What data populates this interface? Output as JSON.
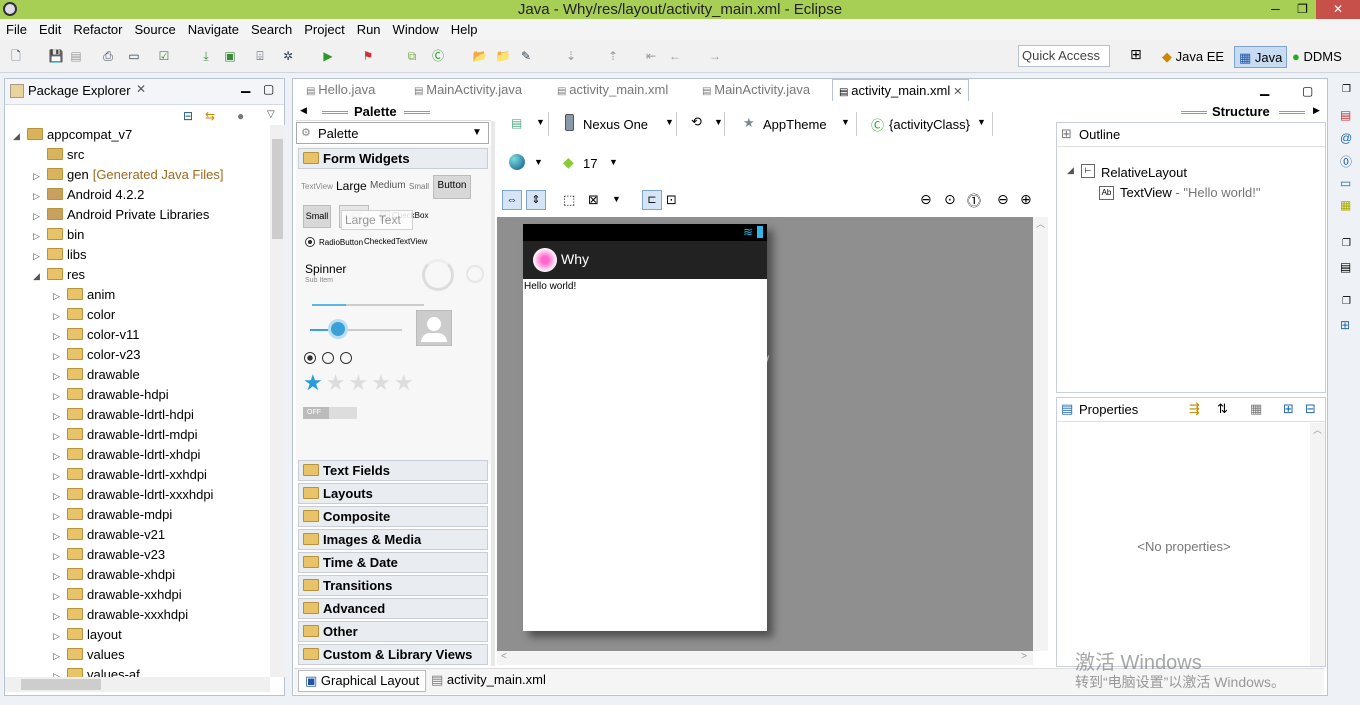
{
  "window": {
    "title": "Java - Why/res/layout/activity_main.xml - Eclipse"
  },
  "menu": [
    "File",
    "Edit",
    "Refactor",
    "Source",
    "Navigate",
    "Search",
    "Project",
    "Run",
    "Window",
    "Help"
  ],
  "toolbar": {
    "quick_access": "Quick Access",
    "perspectives": [
      "Java EE",
      "Java",
      "DDMS"
    ]
  },
  "package_explorer": {
    "title": "Package Explorer",
    "items": [
      {
        "label": "appcompat_v7",
        "depth": 0,
        "arrow": "expanded",
        "icon": "project-icon"
      },
      {
        "label": "src",
        "depth": 1,
        "arrow": "none",
        "icon": "src-folder-icon"
      },
      {
        "label": "gen",
        "extra": "[Generated Java Files]",
        "depth": 1,
        "arrow": "collapsed",
        "icon": "src-folder-icon"
      },
      {
        "label": "Android 4.2.2",
        "depth": 1,
        "arrow": "collapsed",
        "icon": "library-icon"
      },
      {
        "label": "Android Private Libraries",
        "depth": 1,
        "arrow": "collapsed",
        "icon": "library-icon"
      },
      {
        "label": "bin",
        "depth": 1,
        "arrow": "collapsed",
        "icon": "folder-icon"
      },
      {
        "label": "libs",
        "depth": 1,
        "arrow": "collapsed",
        "icon": "folder-icon"
      },
      {
        "label": "res",
        "depth": 1,
        "arrow": "expanded",
        "icon": "folder-icon"
      },
      {
        "label": "anim",
        "depth": 2,
        "arrow": "collapsed",
        "icon": "folder-icon"
      },
      {
        "label": "color",
        "depth": 2,
        "arrow": "collapsed",
        "icon": "folder-icon"
      },
      {
        "label": "color-v11",
        "depth": 2,
        "arrow": "collapsed",
        "icon": "folder-icon"
      },
      {
        "label": "color-v23",
        "depth": 2,
        "arrow": "collapsed",
        "icon": "folder-icon"
      },
      {
        "label": "drawable",
        "depth": 2,
        "arrow": "collapsed",
        "icon": "folder-icon"
      },
      {
        "label": "drawable-hdpi",
        "depth": 2,
        "arrow": "collapsed",
        "icon": "folder-icon"
      },
      {
        "label": "drawable-ldrtl-hdpi",
        "depth": 2,
        "arrow": "collapsed",
        "icon": "folder-icon"
      },
      {
        "label": "drawable-ldrtl-mdpi",
        "depth": 2,
        "arrow": "collapsed",
        "icon": "folder-icon"
      },
      {
        "label": "drawable-ldrtl-xhdpi",
        "depth": 2,
        "arrow": "collapsed",
        "icon": "folder-icon"
      },
      {
        "label": "drawable-ldrtl-xxhdpi",
        "depth": 2,
        "arrow": "collapsed",
        "icon": "folder-icon"
      },
      {
        "label": "drawable-ldrtl-xxxhdpi",
        "depth": 2,
        "arrow": "collapsed",
        "icon": "folder-icon"
      },
      {
        "label": "drawable-mdpi",
        "depth": 2,
        "arrow": "collapsed",
        "icon": "folder-icon"
      },
      {
        "label": "drawable-v21",
        "depth": 2,
        "arrow": "collapsed",
        "icon": "folder-icon"
      },
      {
        "label": "drawable-v23",
        "depth": 2,
        "arrow": "collapsed",
        "icon": "folder-icon"
      },
      {
        "label": "drawable-xhdpi",
        "depth": 2,
        "arrow": "collapsed",
        "icon": "folder-icon"
      },
      {
        "label": "drawable-xxhdpi",
        "depth": 2,
        "arrow": "collapsed",
        "icon": "folder-icon"
      },
      {
        "label": "drawable-xxxhdpi",
        "depth": 2,
        "arrow": "collapsed",
        "icon": "folder-icon"
      },
      {
        "label": "layout",
        "depth": 2,
        "arrow": "collapsed",
        "icon": "folder-icon"
      },
      {
        "label": "values",
        "depth": 2,
        "arrow": "collapsed",
        "icon": "folder-icon"
      },
      {
        "label": "values-af",
        "depth": 2,
        "arrow": "collapsed",
        "icon": "folder-icon"
      }
    ]
  },
  "editor_tabs": [
    {
      "label": "Hello.java",
      "active": false
    },
    {
      "label": "MainActivity.java",
      "active": false
    },
    {
      "label": "activity_main.xml",
      "active": false
    },
    {
      "label": "MainActivity.java",
      "active": false
    },
    {
      "label": "activity_main.xml",
      "active": true
    }
  ],
  "palette": {
    "header": "Palette",
    "dropdown": "Palette",
    "form_widgets": "Form Widgets",
    "tv_sizes": {
      "tv": "TextView",
      "large": "Large",
      "medium": "Medium",
      "small": "Small",
      "button": "Button"
    },
    "small_btn": "Small",
    "off": "OFF",
    "checkbox": "CheckBox",
    "drag_ghost": "Large Text",
    "radio": "RadioButton",
    "checked_tv": "CheckedTextView",
    "spinner": "Spinner",
    "sub_item": "Sub Item",
    "switch_off": "OFF",
    "categories": [
      "Text Fields",
      "Layouts",
      "Composite",
      "Images & Media",
      "Time & Date",
      "Transitions",
      "Advanced",
      "Other",
      "Custom & Library Views"
    ]
  },
  "designer": {
    "device": "Nexus One",
    "theme": "AppTheme",
    "activity": "{activityClass}",
    "api": "17",
    "app_title": "Why",
    "hello": "Hello world!",
    "watermark": "http://blog.csdn.net/"
  },
  "structure": {
    "header": "Structure",
    "outline_title": "Outline",
    "root": "RelativeLayout",
    "child_type": "TextView",
    "child_desc": " - \"Hello world!\""
  },
  "properties": {
    "title": "Properties",
    "empty": "<No properties>"
  },
  "bottom_tabs": [
    "Graphical Layout",
    "activity_main.xml"
  ],
  "activation": {
    "line1": "激活 Windows",
    "line2": "转到“电脑设置”以激活 Windows。"
  }
}
